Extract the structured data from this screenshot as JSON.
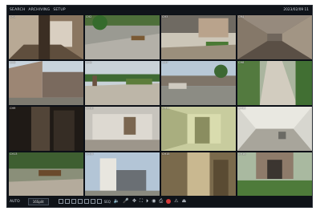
{
  "topbar": {
    "menu": [
      "SEARCH",
      "ARCHIVING",
      "SETUP"
    ],
    "datetime": "2023/02/09 11"
  },
  "grid": {
    "cameras": [
      {
        "label": "CH1",
        "scene": "lobby"
      },
      {
        "label": "CH2",
        "scene": "plaza"
      },
      {
        "label": "CH3",
        "scene": "courtyard"
      },
      {
        "label": "CH4",
        "scene": "corridor"
      },
      {
        "label": "CH5",
        "scene": "building"
      },
      {
        "label": "CH6",
        "scene": "garden"
      },
      {
        "label": "CH7",
        "scene": "street"
      },
      {
        "label": "CH8",
        "scene": "path"
      },
      {
        "label": "CH9",
        "scene": "doorway"
      },
      {
        "label": "CH10",
        "scene": "hall"
      },
      {
        "label": "CH11",
        "scene": "room"
      },
      {
        "label": "CH12",
        "scene": "ceiling"
      },
      {
        "label": "CH13",
        "scene": "bench"
      },
      {
        "label": "CH14",
        "scene": "tower"
      },
      {
        "label": "CH15",
        "scene": "stairwell"
      },
      {
        "label": "CH16",
        "scene": "entrance"
      }
    ]
  },
  "bottombar": {
    "mode_label": "AUTO",
    "split_select": "16Split",
    "seq_label": "SEQ"
  }
}
